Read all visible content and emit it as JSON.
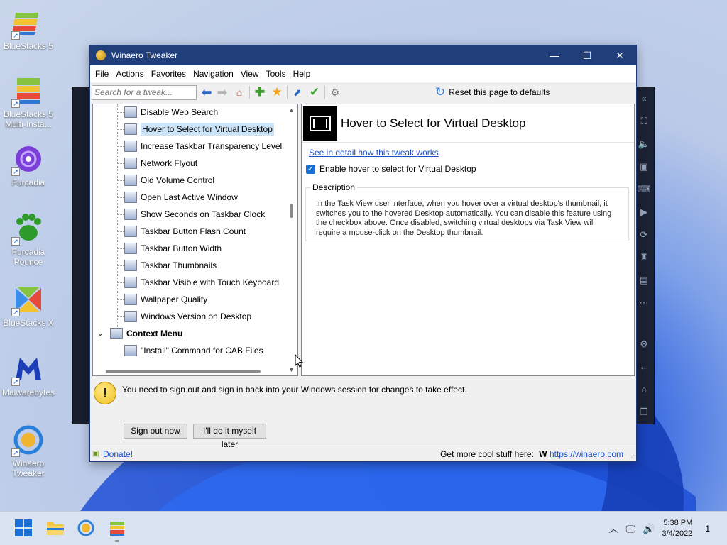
{
  "desktop_icons": [
    {
      "name": "desk-icon-bluestacks5",
      "label": "BlueStacks 5"
    },
    {
      "name": "desk-icon-bluestacks5-multi",
      "label": "BlueStacks 5 Multi-Insta..."
    },
    {
      "name": "desk-icon-furcadia",
      "label": "Furcadia"
    },
    {
      "name": "desk-icon-furcadia-pounce",
      "label": "Furcadia Pounce"
    },
    {
      "name": "desk-icon-bluestacks-x",
      "label": "BlueStacks X"
    },
    {
      "name": "desk-icon-malwarebytes",
      "label": "Malwarebytes"
    },
    {
      "name": "desk-icon-winaero-tweaker",
      "label": "Winaero Tweaker"
    }
  ],
  "window": {
    "title": "Winaero Tweaker",
    "controls": {
      "minimize": "—",
      "maximize": "☐",
      "close": "✕"
    }
  },
  "menu": [
    "File",
    "Actions",
    "Favorites",
    "Navigation",
    "View",
    "Tools",
    "Help"
  ],
  "toolbar": {
    "search_placeholder": "Search for a tweak...",
    "reset_label": "Reset this page to defaults"
  },
  "tree": {
    "items": [
      {
        "label": "Disable Web Search",
        "icon": "search-globe-icon"
      },
      {
        "label": "Hover to Select for Virtual Desktop",
        "icon": "virtual-desktop-icon",
        "selected": true
      },
      {
        "label": "Increase Taskbar Transparency Level",
        "icon": "taskbar-transparency-icon"
      },
      {
        "label": "Network Flyout",
        "icon": "network-icon"
      },
      {
        "label": "Old Volume Control",
        "icon": "volume-icon"
      },
      {
        "label": "Open Last Active Window",
        "icon": "window-icon"
      },
      {
        "label": "Show Seconds on Taskbar Clock",
        "icon": "clock-icon"
      },
      {
        "label": "Taskbar Button Flash Count",
        "icon": "flash-icon"
      },
      {
        "label": "Taskbar Button Width",
        "icon": "taskbar-button-icon"
      },
      {
        "label": "Taskbar Thumbnails",
        "icon": "thumbnails-icon"
      },
      {
        "label": "Taskbar Visible with Touch Keyboard",
        "icon": "keyboard-icon"
      },
      {
        "label": "Wallpaper Quality",
        "icon": "wallpaper-icon"
      },
      {
        "label": "Windows Version on Desktop",
        "icon": "windows-version-icon"
      }
    ],
    "category": "Context Menu",
    "child": "\"Install\" Command for CAB Files"
  },
  "detail": {
    "title": "Hover to Select for Virtual Desktop",
    "link": "See in detail how this tweak works",
    "checkbox_label": "Enable hover to select for Virtual Desktop",
    "checkbox_checked": true,
    "description_legend": "Description",
    "description_text": "In the Task View user interface, when you hover over a virtual desktop's thumbnail, it switches you to the hovered Desktop automatically. You can disable this feature using the checkbox above. Once disabled, switching virtual desktops via Task View will require a mouse-click on the Desktop thumbnail."
  },
  "notice": {
    "text": "You need to sign out and sign in back into your Windows session for changes to take effect.",
    "sign_out": "Sign out now",
    "later": "I'll do it myself later"
  },
  "status": {
    "donate": "Donate!",
    "more_text": "Get more cool stuff here:",
    "url": "https://winaero.com"
  },
  "taskbar": {
    "time": "5:38 PM",
    "date": "3/4/2022",
    "notification_count": "1"
  },
  "colors": {
    "titlebar": "#1f3e7a",
    "accent": "#1b6fd2",
    "link": "#1a4fc8",
    "selection": "#cce4f7"
  }
}
